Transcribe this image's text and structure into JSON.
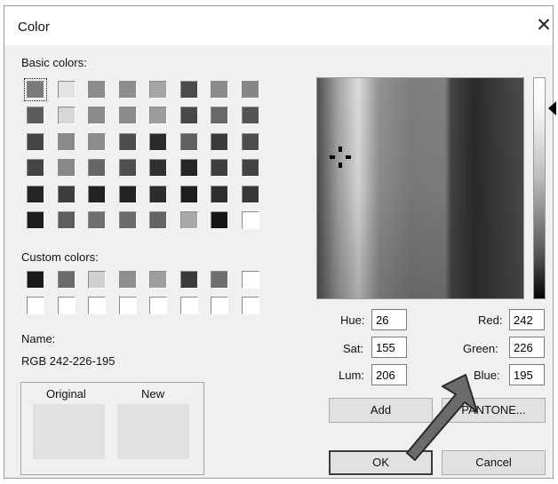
{
  "dialog": {
    "title": "Color",
    "close_glyph": "✕"
  },
  "basic_colors": {
    "label": "Basic colors:",
    "selected_index": 0,
    "swatches": [
      "#7a7a7a",
      "#e3e3e3",
      "#8c8c8c",
      "#8d8d8d",
      "#a6a6a6",
      "#4a4a4a",
      "#8b8b8b",
      "#878787",
      "#5c5c5c",
      "#d7d7d7",
      "#8b8b8b",
      "#8a8a8a",
      "#9c9c9c",
      "#484848",
      "#686868",
      "#545454",
      "#444444",
      "#8a8a8a",
      "#8c8c8c",
      "#4c4c4c",
      "#2a2a2a",
      "#606060",
      "#3a3a3a",
      "#4c4c4c",
      "#444444",
      "#888888",
      "#666666",
      "#505050",
      "#303030",
      "#262626",
      "#3e3e3e",
      "#434343",
      "#242424",
      "#3c3c3c",
      "#222222",
      "#232323",
      "#2c2c2c",
      "#1e1e1e",
      "#2e2e2e",
      "#383838",
      "#1c1c1c",
      "#5d5d5d",
      "#6f6f6f",
      "#6a6a6a",
      "#646464",
      "#a9a9a9",
      "#161616",
      "#ffffff"
    ]
  },
  "custom_colors": {
    "label": "Custom colors:",
    "swatches": [
      "#1a1a1a",
      "#6b6b6b",
      "#cfcfcf",
      "#8f8f8f",
      "#9e9e9e",
      "#3a3a3a",
      "#6f6f6f",
      "#ffffff",
      "#ffffff",
      "#ffffff",
      "#ffffff",
      "#ffffff",
      "#ffffff",
      "#ffffff",
      "#ffffff",
      "#ffffff"
    ]
  },
  "name": {
    "label": "Name:",
    "value": "RGB 242-226-195"
  },
  "preview": {
    "original_label": "Original",
    "new_label": "New",
    "original_color": "#e1e1e1",
    "new_color": "#e1e1e1"
  },
  "fields": {
    "hue": {
      "label": "Hue:",
      "value": "26"
    },
    "sat": {
      "label": "Sat:",
      "value": "155"
    },
    "lum": {
      "label": "Lum:",
      "value": "206"
    },
    "red": {
      "label": "Red:",
      "value": "242"
    },
    "green": {
      "label": "Green:",
      "value": "226"
    },
    "blue": {
      "label": "Blue:",
      "value": "195"
    }
  },
  "buttons": {
    "add": "Add",
    "pantone": "PANTONE...",
    "ok": "OK",
    "cancel": "Cancel"
  },
  "colors": {
    "arrow": "#6b6b6b",
    "arrow_outline": "#2a2a2a"
  }
}
